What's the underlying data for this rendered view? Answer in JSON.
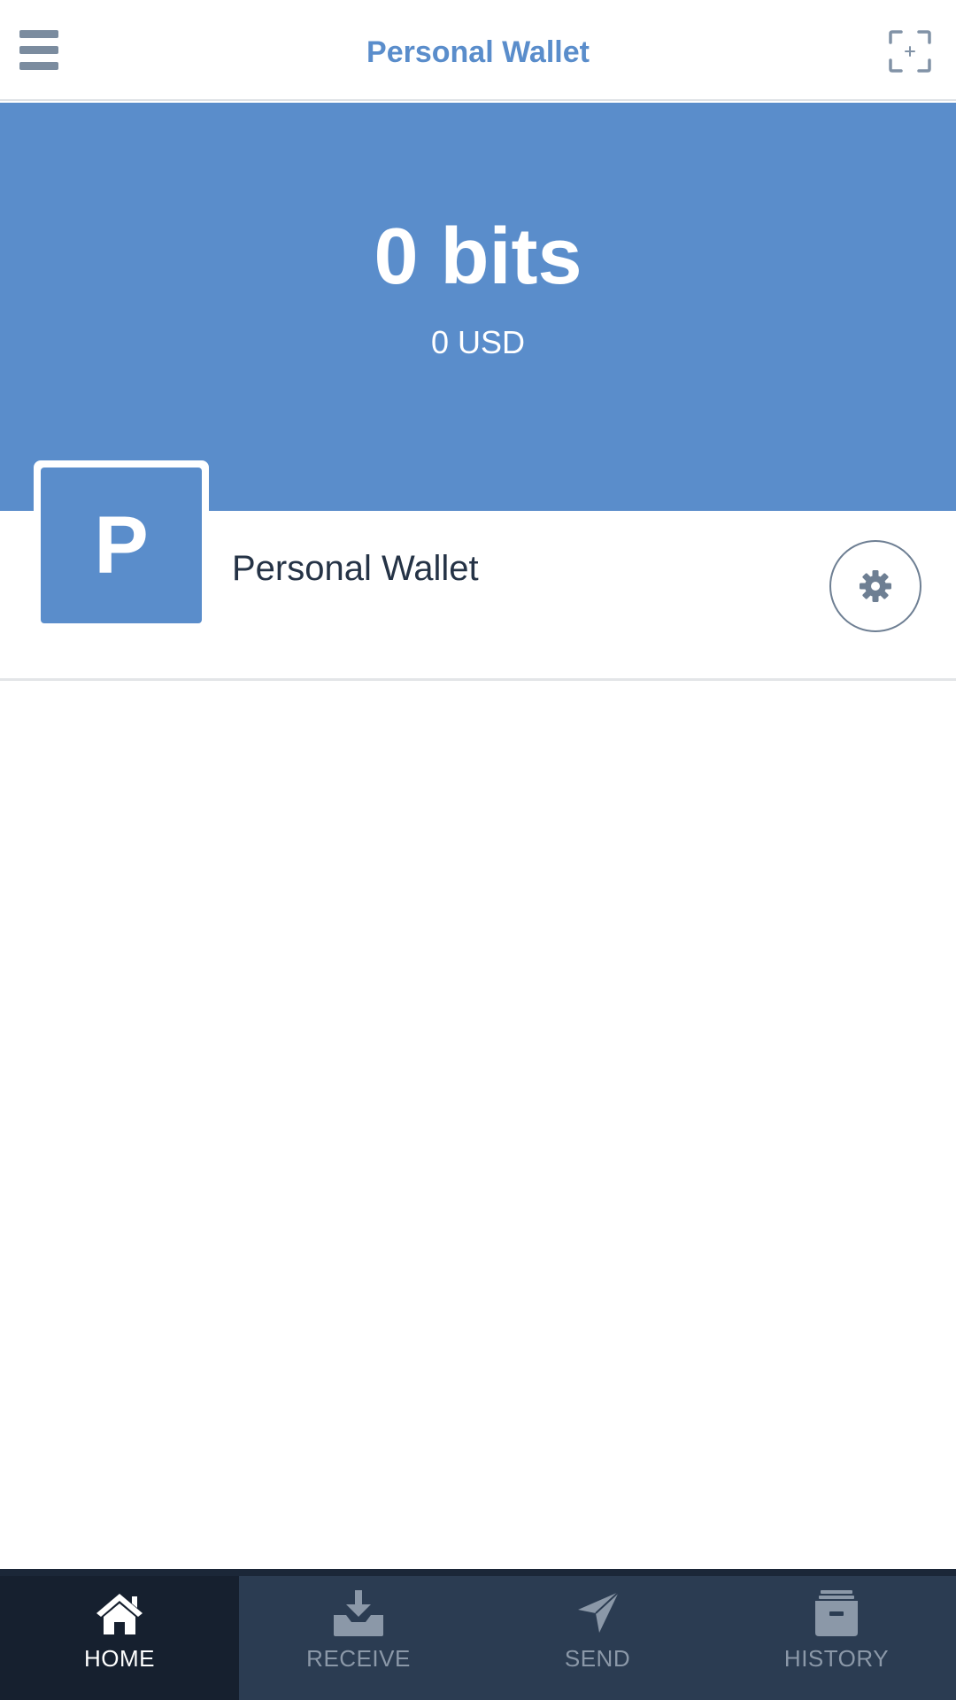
{
  "header": {
    "title": "Personal Wallet",
    "menu_icon": "hamburger-menu-icon",
    "scan_icon": "scan-icon"
  },
  "balance": {
    "amount": "0 bits",
    "alternative": "0 USD"
  },
  "wallet": {
    "avatar_letter": "P",
    "name": "Personal Wallet",
    "settings_icon": "gear-icon"
  },
  "tabs": [
    {
      "label": "HOME",
      "icon": "home-icon",
      "active": true
    },
    {
      "label": "RECEIVE",
      "icon": "receive-icon",
      "active": false
    },
    {
      "label": "SEND",
      "icon": "send-icon",
      "active": false
    },
    {
      "label": "HISTORY",
      "icon": "history-icon",
      "active": false
    }
  ],
  "colors": {
    "brand": "#5a8dcb",
    "tabbar": "#2b3c52",
    "tab_active": "#16202f",
    "text_dark": "#253346"
  }
}
